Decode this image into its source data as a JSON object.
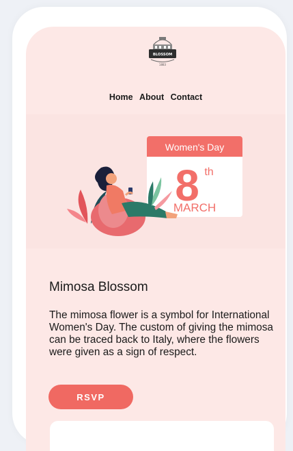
{
  "logo": {
    "brand": "BLOSSOM",
    "year": "1883"
  },
  "nav": {
    "items": [
      "Home",
      "About",
      "Contact"
    ]
  },
  "hero": {
    "banner": "Women's Day",
    "day_number": "8",
    "day_suffix": "th",
    "month": "MARCH"
  },
  "article": {
    "title": "Mimosa Blossom",
    "description": "The mimosa flower is a symbol for International Women's Day. The custom of giving the mimosa can be traced back to Italy, where the flowers were given as a sign of respect."
  },
  "cta": {
    "label": "RSVP"
  },
  "colors": {
    "accent": "#f06962",
    "screen_bg": "#fde8e6",
    "page_bg": "#eef1f6"
  }
}
